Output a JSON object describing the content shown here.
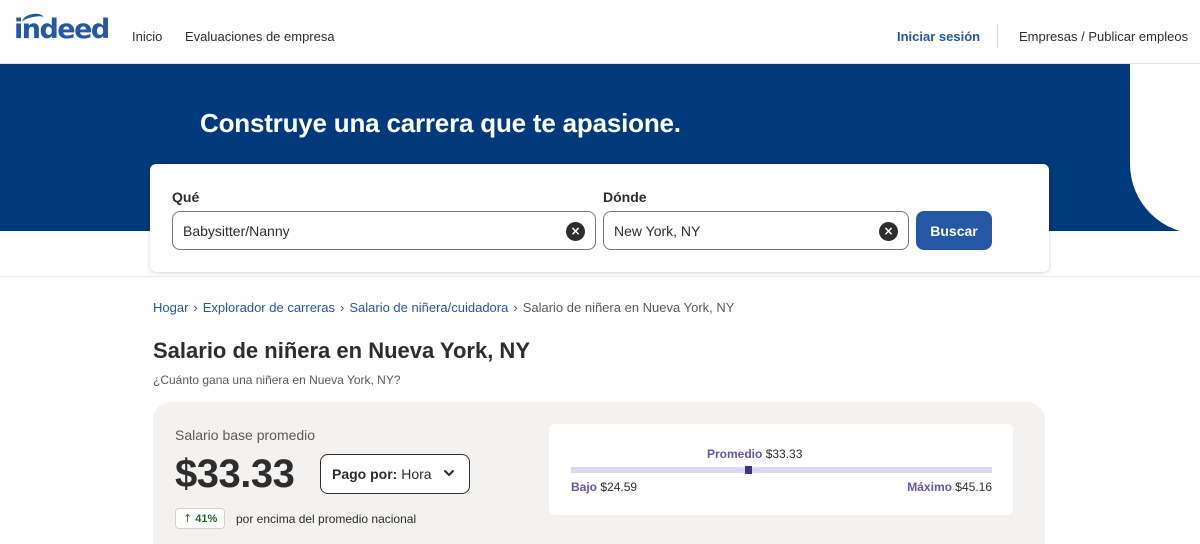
{
  "header": {
    "logo_text": "indeed",
    "nav": {
      "home": "Inicio",
      "company_reviews": "Evaluaciones de empresa"
    },
    "sign_in": "Iniciar sesión",
    "employers": "Empresas / Publicar empleos"
  },
  "hero": {
    "title": "Construye una carrera que te apasione."
  },
  "search": {
    "what_label": "Qué",
    "what_value": "Babysitter/Nanny",
    "where_label": "Dónde",
    "where_value": "New York, NY",
    "button_label": "Buscar",
    "clear_glyph": "×"
  },
  "breadcrumb": {
    "items": [
      "Hogar",
      "Explorador de carreras",
      "Salario de niñera/cuidadora"
    ],
    "current": "Salario de niñera en Nueva York, NY",
    "separator": "›"
  },
  "page": {
    "title": "Salario de niñera en Nueva York, NY",
    "subtitle": "¿Cuánto gana una niñera en Nueva York, NY?"
  },
  "salary": {
    "base_label": "Salario base promedio",
    "amount": "$33.33",
    "pay_by_label": "Pago por:",
    "pay_by_value": "Hora",
    "comparison_pct": "41%",
    "comparison_text": "por encima del promedio nacional",
    "range": {
      "avg_label": "Promedio",
      "avg_value": "$33.33",
      "low_label": "Bajo",
      "low_value": "$24.59",
      "high_label": "Máximo",
      "high_value": "$45.16",
      "avg_fraction": 0.42
    }
  },
  "colors": {
    "brand_blue": "#2557a7",
    "hero_navy": "#003a7d",
    "range_purple": "#6654a8",
    "range_track": "#dcd8f0",
    "range_marker": "#3f2f8f",
    "positive_green": "#1f662c"
  }
}
